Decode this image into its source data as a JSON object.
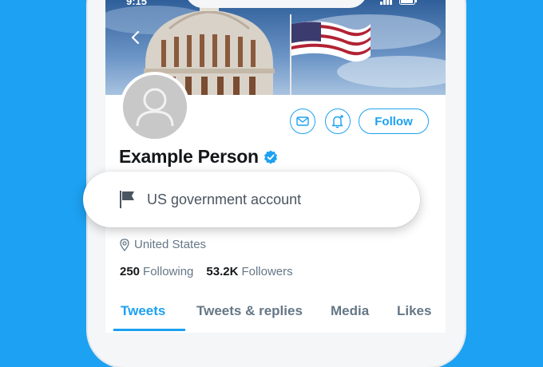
{
  "status": {
    "time": "9:15"
  },
  "profile": {
    "name": "Example Person",
    "label": "US government account",
    "location": "United States",
    "following_count": "250",
    "following_label": "Following",
    "followers_count": "53.2K",
    "followers_label": "Followers"
  },
  "actions": {
    "follow_label": "Follow"
  },
  "tabs": [
    {
      "label": "Tweets",
      "active": true
    },
    {
      "label": "Tweets & replies",
      "active": false
    },
    {
      "label": "Media",
      "active": false
    },
    {
      "label": "Likes",
      "active": false
    }
  ],
  "colors": {
    "accent": "#1da1f2",
    "background": "#1da1f2",
    "text_primary": "#14171a",
    "text_secondary": "#657786"
  },
  "icons": [
    "back-chevron-icon",
    "mail-icon",
    "bell-plus-icon",
    "verified-badge-icon",
    "flag-icon",
    "location-pin-icon"
  ]
}
